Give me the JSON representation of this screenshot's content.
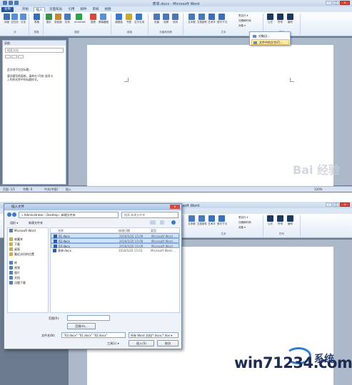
{
  "app": {
    "title": "表单.docx - Microsoft Word",
    "tabs": [
      "文件",
      "开始",
      "插入",
      "页面布局",
      "引用",
      "邮件",
      "审阅",
      "视图"
    ],
    "active_tab": "插入"
  },
  "ribbon": {
    "buttons": [
      {
        "label": "封面",
        "color": "#3b6fb6"
      },
      {
        "label": "空白页",
        "color": "#5b8fd0"
      },
      {
        "label": "分页",
        "color": "#5b8fd0"
      },
      {
        "label": "表格",
        "color": "#2f6fbf"
      },
      {
        "label": "图片",
        "color": "#3f8f4f"
      },
      {
        "label": "剪贴画",
        "color": "#c9892b"
      },
      {
        "label": "形状",
        "color": "#4a78b8"
      },
      {
        "label": "SmartArt",
        "color": "#2ea14a"
      },
      {
        "label": "图表",
        "color": "#d24b3a"
      },
      {
        "label": "屏幕截图",
        "color": "#5b8fd0"
      },
      {
        "label": "超链接",
        "color": "#3b78c9"
      },
      {
        "label": "书签",
        "color": "#c9a83a"
      },
      {
        "label": "交叉引用",
        "color": "#3b78c9"
      },
      {
        "label": "页眉",
        "color": "#4a78b8"
      },
      {
        "label": "页脚",
        "color": "#4a78b8"
      },
      {
        "label": "页码",
        "color": "#4a78b8"
      },
      {
        "label": "文本框",
        "color": "#4a78b8"
      },
      {
        "label": "文档部件",
        "color": "#4a78b8"
      },
      {
        "label": "艺术字",
        "color": "#3b6fb6"
      },
      {
        "label": "首字下沉",
        "color": "#3b6fb6"
      },
      {
        "label": "公式",
        "color": "#1e395b"
      },
      {
        "label": "符号",
        "color": "#1e395b"
      },
      {
        "label": "编号",
        "color": "#1e395b"
      }
    ],
    "groups": [
      "页",
      "表格",
      "插图",
      "链接",
      "页眉和页脚",
      "文本",
      "符号"
    ],
    "text_side": [
      "签名行 ▾",
      "日期和时间",
      "对象 ▾"
    ]
  },
  "object_menu": {
    "items": [
      "对象(J)...",
      "文件中的文字(F)..."
    ],
    "highlight": 1
  },
  "nav_pane": {
    "title": "导航",
    "search_placeholder": "搜索文档",
    "message": "此文档不包含标题。若要创建导航窗格，请使用标题样式...",
    "message_line1": "此文档不包含标题。",
    "message_line2": "要创建导航窗格，请单击\"开始\"选项卡",
    "message_line3": "上的样式库中的标题样式。"
  },
  "status": {
    "page": "页面: 1/1",
    "words": "字数: 0",
    "lang": "中文(中国)",
    "mode": "插入",
    "zoom": "120%"
  },
  "dialog": {
    "title": "插入文件",
    "path": "« Administrator › Desktop › 新建文件夹",
    "search_placeholder": "搜索 新建文件夹",
    "organize": "组织 ▾",
    "new_folder": "新建文件夹",
    "columns": {
      "name": "名称",
      "date": "修改日期",
      "type": "类型"
    },
    "files": [
      {
        "name": "01.docx",
        "date": "2016/5/20 15:09",
        "type": "Microsoft Word ...",
        "selected": true
      },
      {
        "name": "02.docx",
        "date": "2016/5/20 15:09",
        "type": "Microsoft Word ...",
        "selected": true
      },
      {
        "name": "03.docx",
        "date": "2016/5/20 15:09",
        "type": "Microsoft Word ...",
        "selected": true
      },
      {
        "name": "表单.docx",
        "date": "2016/5/20 15:03",
        "type": "Microsoft Word ...",
        "selected": false
      }
    ],
    "sidebar": [
      "Microsoft Word",
      "收藏夹",
      "下载",
      "桌面",
      "最近访问的位置",
      "库",
      "视频",
      "图片",
      "文档",
      "迅雷下载"
    ],
    "range_label": "范围(R):",
    "range_button": "范围(A)...",
    "filename_label": "文件名(N):",
    "filename_value": "\"03.docx\" \"01.docx\" \"02.docx\"",
    "filetype_value": "所有 Word 文档(*.docx;*.doc ▾",
    "tools": "工具(L) ▾",
    "insert": "插入(S)",
    "cancel": "取消"
  },
  "watermark": {
    "text": "win71234.com",
    "text2": "系统"
  }
}
